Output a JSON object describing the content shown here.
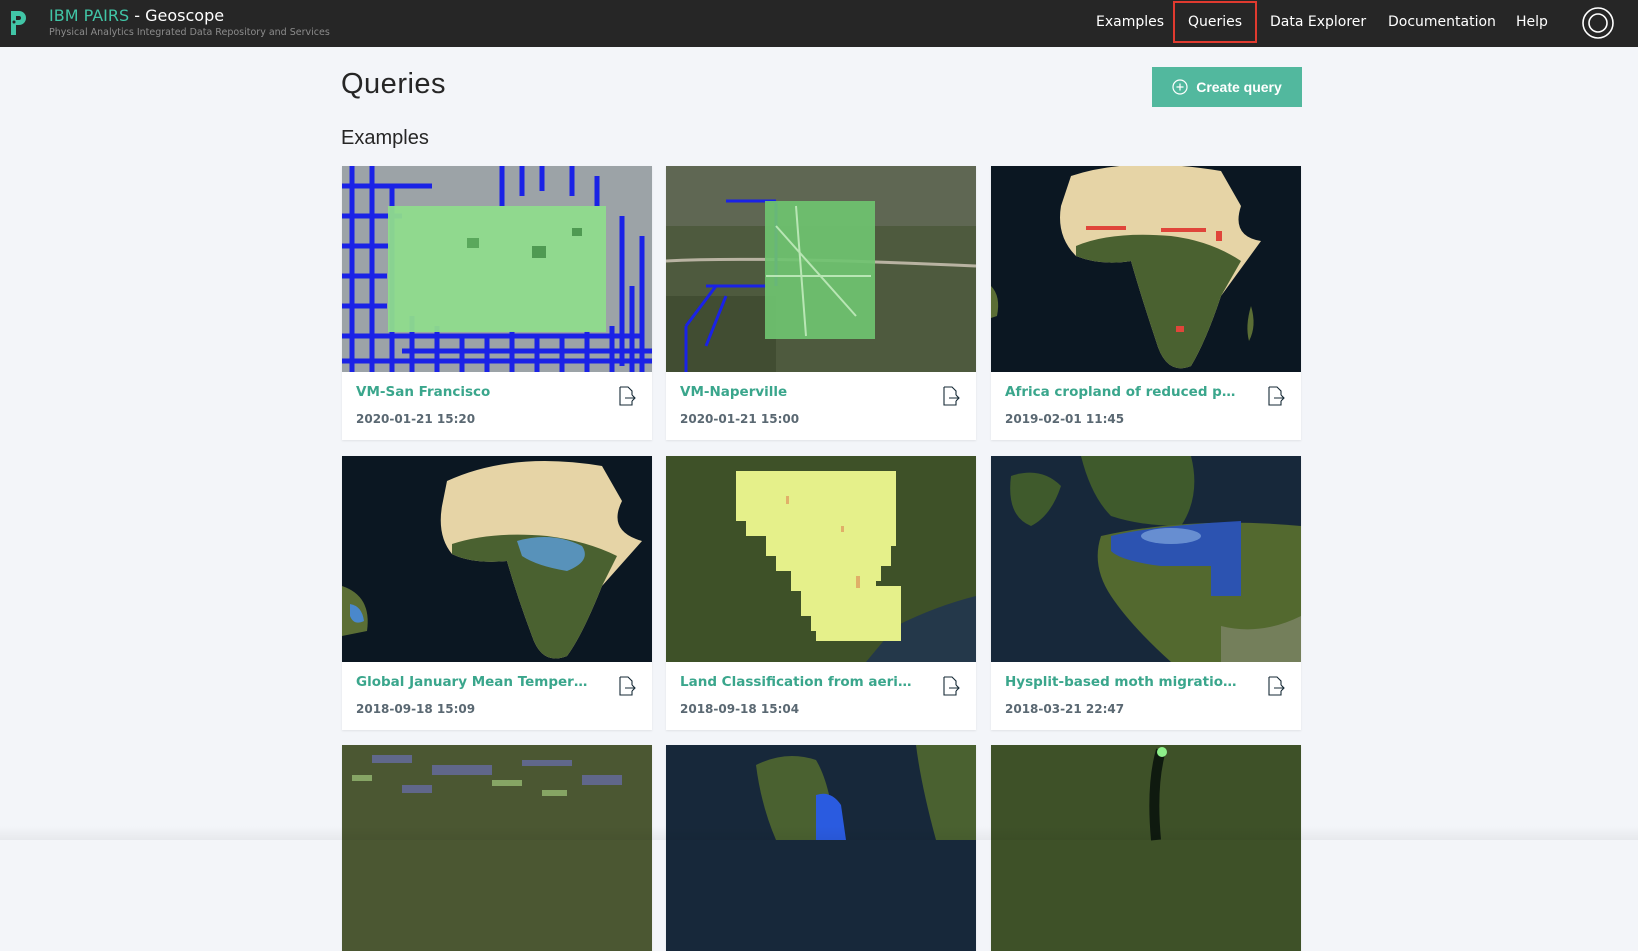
{
  "header": {
    "brand_name": "IBM PAIRS",
    "brand_sep": " - ",
    "brand_product": "Geoscope",
    "brand_subtitle": "Physical Analytics Integrated Data Repository and Services",
    "nav": [
      {
        "label": "Examples"
      },
      {
        "label": "Queries",
        "active": true
      },
      {
        "label": "Data Explorer"
      },
      {
        "label": "Documentation"
      },
      {
        "label": "Help"
      }
    ],
    "accent_color": "#41c5a6",
    "highlight_color": "#e03a2f"
  },
  "main": {
    "page_title": "Queries",
    "create_label": "Create query",
    "section_title": "Examples",
    "cards": [
      {
        "name": "VM-San Francisco",
        "date": "2020-01-21 15:20"
      },
      {
        "name": "VM-Naperville",
        "date": "2020-01-21 15:00"
      },
      {
        "name": "Africa cropland of reduced precip...",
        "date": "2019-02-01 11:45"
      },
      {
        "name": "Global January Mean Temperatur...",
        "date": "2018-09-18 15:09"
      },
      {
        "name": "Land Classification from aerial im...",
        "date": "2018-09-18 15:04"
      },
      {
        "name": "Hysplit-based moth migration for...",
        "date": "2018-03-21 22:47"
      }
    ],
    "button_color": "#52b89e",
    "link_color": "#3aa68c"
  }
}
